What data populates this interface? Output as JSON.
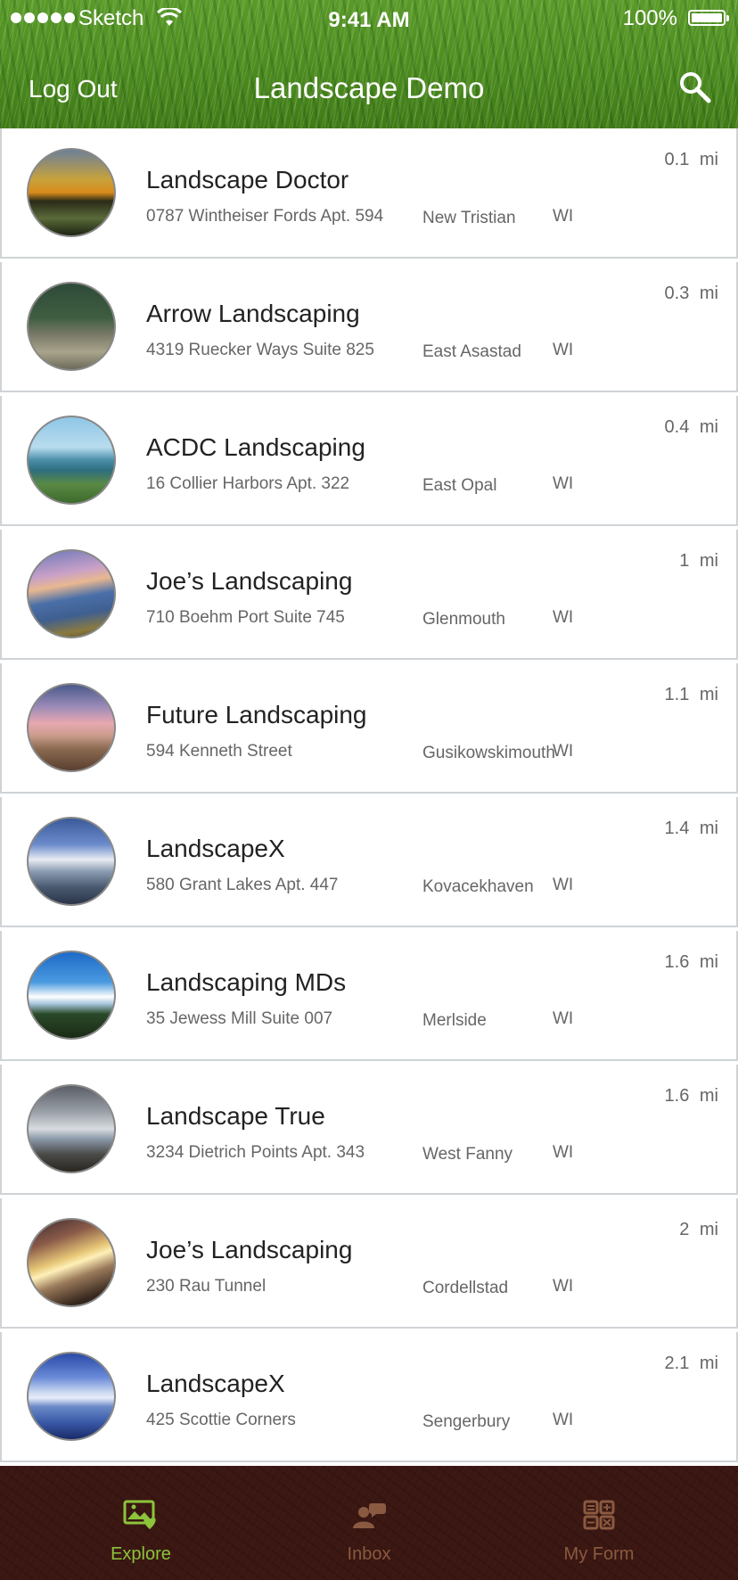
{
  "status_bar": {
    "carrier": "Sketch",
    "time": "9:41 AM",
    "battery": "100%"
  },
  "nav": {
    "left_button": "Log Out",
    "title": "Landscape Demo",
    "search_icon": "search-icon"
  },
  "listings": [
    {
      "name": "Landscape Doctor",
      "street": "0787 Wintheiser Fords Apt. 594",
      "city": "New Tristian",
      "state": "WI",
      "distance": "0.1 mi"
    },
    {
      "name": "Arrow Landscaping",
      "street": "4319 Ruecker Ways Suite 825",
      "city": "East Asastad",
      "state": "WI",
      "distance": "0.3 mi"
    },
    {
      "name": "ACDC Landscaping",
      "street": "16 Collier Harbors Apt. 322",
      "city": "East Opal",
      "state": "WI",
      "distance": "0.4 mi"
    },
    {
      "name": "Joe’s Landscaping",
      "street": "710 Boehm Port Suite 745",
      "city": "Glenmouth",
      "state": "WI",
      "distance": "1 mi"
    },
    {
      "name": "Future Landscaping",
      "street": "594 Kenneth Street",
      "city": "Gusikowskimouth",
      "state": "WI",
      "distance": "1.1 mi"
    },
    {
      "name": "LandscapeX",
      "street": "580 Grant Lakes Apt. 447",
      "city": "Kovacekhaven",
      "state": "WI",
      "distance": "1.4 mi"
    },
    {
      "name": "Landscaping MDs",
      "street": "35 Jewess Mill Suite 007",
      "city": "Merlside",
      "state": "WI",
      "distance": "1.6 mi"
    },
    {
      "name": "Landscape True",
      "street": "3234 Dietrich Points Apt. 343",
      "city": "West Fanny",
      "state": "WI",
      "distance": "1.6 mi"
    },
    {
      "name": "Joe’s Landscaping",
      "street": "230 Rau Tunnel",
      "city": "Cordellstad",
      "state": "WI",
      "distance": "2 mi"
    },
    {
      "name": "LandscapeX",
      "street": "425 Scottie Corners",
      "city": "Sengerbury",
      "state": "WI",
      "distance": "2.1 mi"
    }
  ],
  "tabs": [
    {
      "label": "Explore",
      "icon": "explore-icon",
      "active": true
    },
    {
      "label": "Inbox",
      "icon": "inbox-icon",
      "active": false
    },
    {
      "label": "My Form",
      "icon": "my-form-icon",
      "active": false
    }
  ],
  "colors": {
    "active_tab": "#8cc43c",
    "inactive_tab": "#8a5a40",
    "header_green": "#4f8e22",
    "tabbar_brown": "#3a1712"
  }
}
